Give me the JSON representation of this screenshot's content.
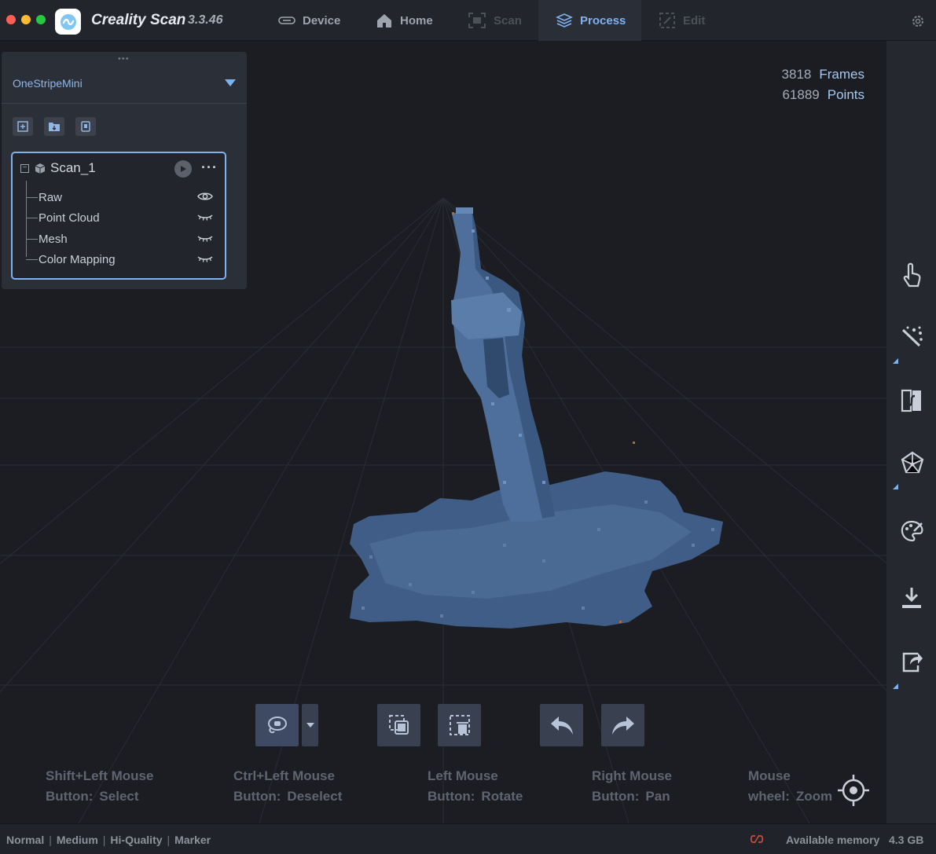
{
  "app": {
    "name": "Creality Scan",
    "version": "3.3.46"
  },
  "tabs": [
    {
      "label": "Device",
      "icon": "device-icon",
      "state": "normal"
    },
    {
      "label": "Home",
      "icon": "home-icon",
      "state": "normal"
    },
    {
      "label": "Scan",
      "icon": "scan-icon",
      "state": "disabled"
    },
    {
      "label": "Process",
      "icon": "layers-icon",
      "state": "active"
    },
    {
      "label": "Edit",
      "icon": "edit-icon",
      "state": "disabled"
    }
  ],
  "stats": {
    "frames_value": "3818",
    "frames_label": "Frames",
    "points_value": "61889",
    "points_label": "Points"
  },
  "panel": {
    "device": "OneStripeMini",
    "tools": [
      "add-project-icon",
      "open-folder-icon",
      "device-file-icon"
    ],
    "project": {
      "name": "Scan_1",
      "items": [
        {
          "label": "Raw",
          "visible": true
        },
        {
          "label": "Point Cloud",
          "visible": false
        },
        {
          "label": "Mesh",
          "visible": false
        },
        {
          "label": "Color Mapping",
          "visible": false
        }
      ]
    }
  },
  "toolbar": {
    "buttons": [
      "lasso-select-icon",
      "select-mode-dropdown-icon",
      "invert-selection-icon",
      "delete-selection-icon",
      "undo-icon",
      "redo-icon"
    ]
  },
  "hints": [
    {
      "line1": "Shift+Left Mouse",
      "line2_key": "Button:",
      "line2_val": "Select"
    },
    {
      "line1": "Ctrl+Left Mouse",
      "line2_key": "Button:",
      "line2_val": "Deselect"
    },
    {
      "line1": "Left Mouse",
      "line2_key": "Button:",
      "line2_val": "Rotate"
    },
    {
      "line1": "Right Mouse",
      "line2_key": "Button:",
      "line2_val": "Pan"
    },
    {
      "line1": "Mouse",
      "line2_key": "wheel:",
      "line2_val": "Zoom"
    }
  ],
  "right_tools": [
    "touch-icon",
    "magic-wand-icon",
    "align-icon",
    "mesh-icon",
    "texture-palette-icon",
    "download-icon",
    "share-icon"
  ],
  "status": {
    "modes": [
      "Normal",
      "Medium",
      "Hi-Quality",
      "Marker"
    ],
    "memory_label": "Available memory",
    "memory_value": "4.3 GB"
  },
  "colors": {
    "accent": "#7fb1ee",
    "background": "#1b1d23",
    "scan_model": "#4a6a94"
  }
}
